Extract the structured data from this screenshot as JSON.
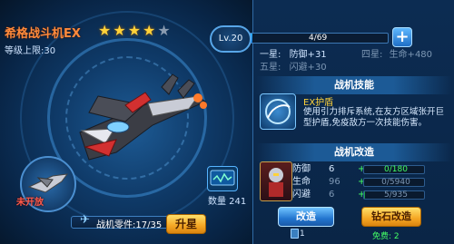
{
  "aircraft": {
    "name": "希格战斗机EX",
    "stars_filled": 4,
    "stars_total": 5,
    "level_cap_label": "等级上限:30"
  },
  "level": {
    "badge": "Lv.20",
    "exp_text": "4/69",
    "exp_fraction": 0.058
  },
  "star_bonuses": [
    {
      "tier": "一星:",
      "stat": "防御+31"
    },
    {
      "tier": "四星:",
      "stat": "生命+480"
    },
    {
      "tier": "五星:",
      "stat": "闪避+30"
    }
  ],
  "skill_section": {
    "title": "战机技能",
    "skill_name": "EX护盾",
    "skill_desc": "使用引力排斥系统,在友方区域张开巨型护盾,免疫敌方一次技能伤害。"
  },
  "mod_section": {
    "title": "战机改造",
    "rows": [
      {
        "label": "防御",
        "value": "6",
        "plus": "+",
        "progress": "0/180",
        "fill": 0.0,
        "color": "#44ff66"
      },
      {
        "label": "生命",
        "value": "96",
        "plus": "+",
        "progress": "0/5940",
        "fill": 0.0,
        "color": "#7d97b4"
      },
      {
        "label": "闪避",
        "value": "6",
        "plus": "+",
        "progress": "5/935",
        "fill": 0.01,
        "color": "#7d97b4"
      }
    ],
    "modify_button": "改造",
    "diamond_button": "钻石改造",
    "cost": "1",
    "free_text": "免费: 2"
  },
  "bottom": {
    "parts_label": "战机零件:17/35",
    "upgrade_button": "升星",
    "qty_label": "数量 241"
  },
  "side_aircraft": {
    "status": "未开放"
  },
  "colors": {
    "accent_orange": "#ff8a3c",
    "gold": "#ffd23a",
    "green": "#44ff66",
    "panel_blue": "#1c5a96"
  }
}
